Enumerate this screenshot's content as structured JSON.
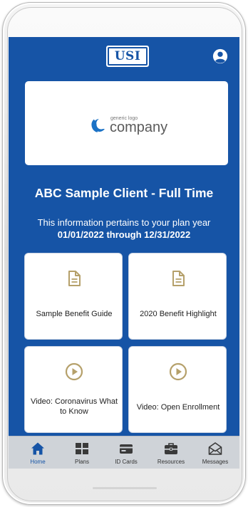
{
  "header": {
    "brand_logo_text": "USI",
    "profile_icon": "user-circle-icon"
  },
  "client_logo": {
    "small_text": "generic logo",
    "big_text": "company"
  },
  "client": {
    "title": "ABC Sample Client - Full Time",
    "plan_info_line1": "This information pertains to your plan year",
    "plan_info_line2": "01/01/2022 through 12/31/2022"
  },
  "tiles": [
    {
      "label": "Sample Benefit Guide",
      "icon": "document-icon"
    },
    {
      "label": "2020 Benefit Highlight",
      "icon": "document-icon"
    },
    {
      "label": "Video: Coronavirus  What to Know",
      "icon": "play-circle-icon"
    },
    {
      "label": "Video: Open Enrollment",
      "icon": "play-circle-icon"
    }
  ],
  "tabbar": {
    "active": "Home",
    "items": [
      {
        "label": "Home",
        "icon": "home-icon"
      },
      {
        "label": "Plans",
        "icon": "grid-icon"
      },
      {
        "label": "ID Cards",
        "icon": "id-card-icon"
      },
      {
        "label": "Resources",
        "icon": "toolbox-icon"
      },
      {
        "label": "Messages",
        "icon": "envelope-icon"
      }
    ]
  },
  "colors": {
    "primary_blue": "#1654a6",
    "tile_icon_gold": "#b5a06a",
    "tabbar_bg": "#cfd3d8",
    "card_white": "#ffffff"
  }
}
